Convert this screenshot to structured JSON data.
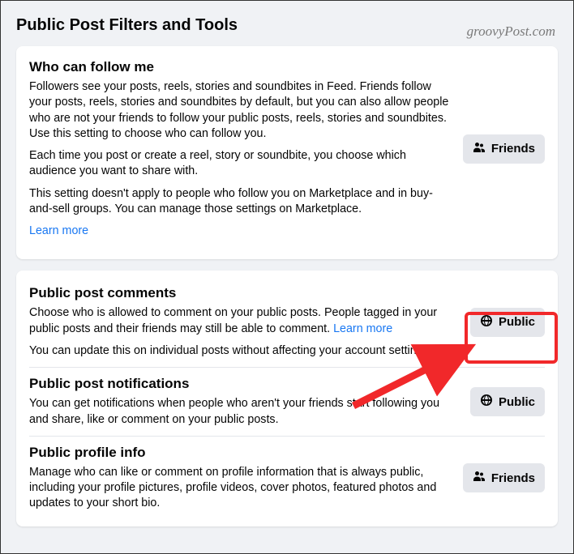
{
  "pageTitle": "Public Post Filters and Tools",
  "watermark": "groovyPost.com",
  "followSection": {
    "title": "Who can follow me",
    "p1": "Followers see your posts, reels, stories and soundbites in Feed. Friends follow your posts, reels, stories and soundbites by default, but you can also allow people who are not your friends to follow your public posts, reels, stories and soundbites. Use this setting to choose who can follow you.",
    "p2": "Each time you post or create a reel, story or soundbite, you choose which audience you want to share with.",
    "p3": "This setting doesn't apply to people who follow you on Marketplace and in buy-and-sell groups. You can manage those settings on Marketplace.",
    "learnMore": "Learn more",
    "button": "Friends",
    "buttonIcon": "friends-icon"
  },
  "commentsSection": {
    "title": "Public post comments",
    "desc1a": "Choose who is allowed to comment on your public posts. People tagged in your public posts and their friends may still be able to comment. ",
    "learnMore": "Learn more",
    "desc2": "You can update this on individual posts without affecting your account settings.",
    "button": "Public",
    "buttonIcon": "globe-icon"
  },
  "notificationsSection": {
    "title": "Public post notifications",
    "desc": "You can get notifications when people who aren't your friends start following you and share, like or comment on your public posts.",
    "button": "Public",
    "buttonIcon": "globe-icon"
  },
  "profileSection": {
    "title": "Public profile info",
    "desc": "Manage who can like or comment on profile information that is always public, including your profile pictures, profile videos, cover photos, featured photos and updates to your short bio.",
    "button": "Friends",
    "buttonIcon": "friends-icon"
  }
}
